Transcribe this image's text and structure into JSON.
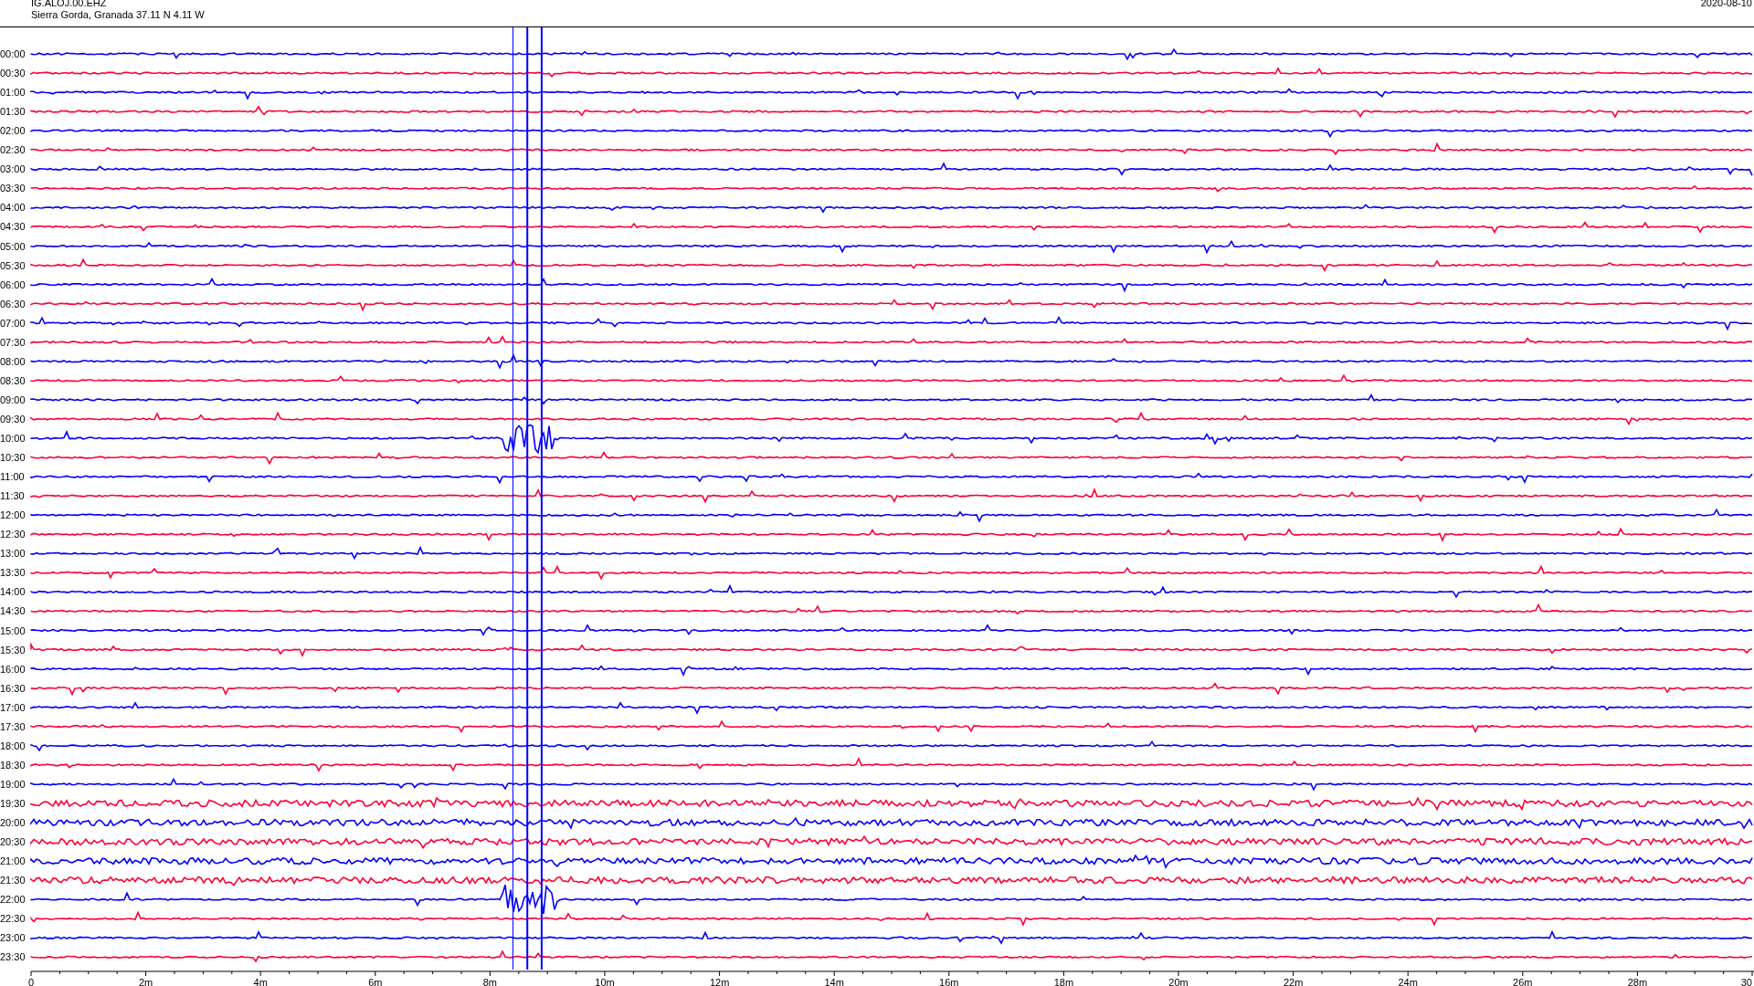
{
  "header": {
    "station": "IG.ALOJ.00.EHZ",
    "location": "Sierra Gorda, Granada  37.11 N 4.11 W",
    "date": "2020-08-10"
  },
  "rows": [
    {
      "time": "00:00",
      "color": "#0000ff"
    },
    {
      "time": "00:30",
      "color": "#ff0033"
    },
    {
      "time": "01:00",
      "color": "#0000ff"
    },
    {
      "time": "01:30",
      "color": "#ff0033"
    },
    {
      "time": "02:00",
      "color": "#0000ff"
    },
    {
      "time": "02:30",
      "color": "#ff0033"
    },
    {
      "time": "03:00",
      "color": "#0000ff"
    },
    {
      "time": "03:30",
      "color": "#ff0033"
    },
    {
      "time": "04:00",
      "color": "#0000ff"
    },
    {
      "time": "04:30",
      "color": "#ff0033"
    },
    {
      "time": "05:00",
      "color": "#0000ff"
    },
    {
      "time": "05:30",
      "color": "#ff0033"
    },
    {
      "time": "06:00",
      "color": "#0000ff"
    },
    {
      "time": "06:30",
      "color": "#ff0033"
    },
    {
      "time": "07:00",
      "color": "#0000ff"
    },
    {
      "time": "07:30",
      "color": "#ff0033"
    },
    {
      "time": "08:00",
      "color": "#0000ff"
    },
    {
      "time": "08:30",
      "color": "#ff0033"
    },
    {
      "time": "09:00",
      "color": "#0000ff"
    },
    {
      "time": "09:30",
      "color": "#ff0033"
    },
    {
      "time": "10:00",
      "color": "#0000ff"
    },
    {
      "time": "10:30",
      "color": "#ff0033"
    },
    {
      "time": "11:00",
      "color": "#0000ff"
    },
    {
      "time": "11:30",
      "color": "#ff0033"
    },
    {
      "time": "12:00",
      "color": "#0000ff"
    },
    {
      "time": "12:30",
      "color": "#ff0033"
    },
    {
      "time": "13:00",
      "color": "#0000ff"
    },
    {
      "time": "13:30",
      "color": "#ff0033"
    },
    {
      "time": "14:00",
      "color": "#0000ff"
    },
    {
      "time": "14:30",
      "color": "#ff0033"
    },
    {
      "time": "15:00",
      "color": "#0000ff"
    },
    {
      "time": "15:30",
      "color": "#ff0033"
    },
    {
      "time": "16:00",
      "color": "#0000ff"
    },
    {
      "time": "16:30",
      "color": "#ff0033"
    },
    {
      "time": "17:00",
      "color": "#0000ff"
    },
    {
      "time": "17:30",
      "color": "#ff0033"
    },
    {
      "time": "18:00",
      "color": "#0000ff"
    },
    {
      "time": "18:30",
      "color": "#ff0033"
    },
    {
      "time": "19:00",
      "color": "#0000ff"
    },
    {
      "time": "19:30",
      "color": "#ff0033"
    },
    {
      "time": "20:00",
      "color": "#0000ff"
    },
    {
      "time": "20:30",
      "color": "#ff0033"
    },
    {
      "time": "21:00",
      "color": "#0000ff"
    },
    {
      "time": "21:30",
      "color": "#ff0033"
    },
    {
      "time": "22:00",
      "color": "#0000ff"
    },
    {
      "time": "22:30",
      "color": "#ff0033"
    },
    {
      "time": "23:00",
      "color": "#0000ff"
    },
    {
      "time": "23:30",
      "color": "#ff0033"
    }
  ],
  "x_axis": {
    "ticks": [
      "0",
      "2m",
      "4m",
      "6m",
      "8m",
      "10m",
      "12m",
      "14m",
      "16m",
      "18m",
      "20m",
      "22m",
      "24m",
      "26m",
      "28m",
      "30"
    ]
  }
}
